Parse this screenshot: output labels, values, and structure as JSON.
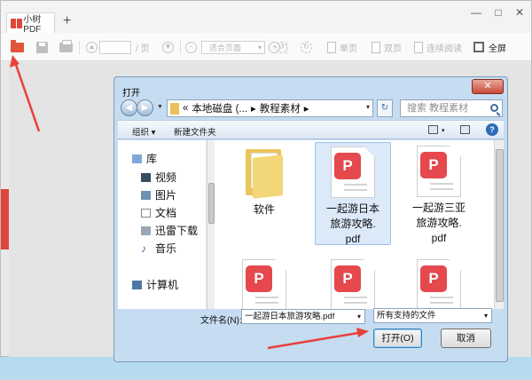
{
  "app": {
    "tab_title": "小树PDF",
    "tab_add": "+",
    "window_controls": {
      "minimize": "—",
      "maximize": "□",
      "close": "✕"
    }
  },
  "toolbar": {
    "page_suffix": "/ 页",
    "zoom_value": "适合页面",
    "single_page": "单页",
    "double_page": "双页",
    "continuous_read": "连续阅读",
    "fullscreen": "全屏",
    "icons": [
      "folder-open-icon",
      "save-icon",
      "print-icon",
      "page-up-icon",
      "page-down-icon",
      "zoom-out-icon",
      "zoom-in-icon",
      "rotate-left-icon",
      "rotate-right-icon",
      "fullscreen-icon"
    ]
  },
  "dialog": {
    "title": "打开",
    "close": "✕",
    "path": {
      "prefix": "«",
      "segments": [
        "本地磁盘 (...",
        "▸",
        "教程素材",
        "▸"
      ]
    },
    "search_placeholder": "搜索 教程素材",
    "commands": {
      "organize": "组织 ▾",
      "new_folder": "新建文件夹"
    },
    "tree": {
      "library": "库",
      "videos": "视频",
      "pictures": "图片",
      "documents": "文档",
      "thunder_downloads": "迅雷下载",
      "music": "音乐",
      "computer": "计算机"
    },
    "files": [
      {
        "name": "软件",
        "kind": "folder"
      },
      {
        "name": "一起游日本旅游攻略.pdf",
        "line1": "一起游日本",
        "line2": "旅游攻略.",
        "line3": "pdf",
        "kind": "pdf",
        "selected": true
      },
      {
        "name": "一起游三亚旅游攻略.pdf",
        "line1": "一起游三亚",
        "line2": "旅游攻略.",
        "line3": "pdf",
        "kind": "pdf"
      },
      {
        "kind": "pdf"
      },
      {
        "kind": "pdf"
      },
      {
        "kind": "pdf"
      }
    ],
    "filename_label": "文件名(N):",
    "filename_value": "一起游日本旅游攻略.pdf",
    "filetype_value": "所有支持的文件",
    "open_button": "打开(O)",
    "cancel_button": "取消"
  },
  "colors": {
    "accent": "#e0453c",
    "pdf_badge": "#e5484d",
    "folder": "#e9c659",
    "annotation_arrow": "#e8403a"
  }
}
